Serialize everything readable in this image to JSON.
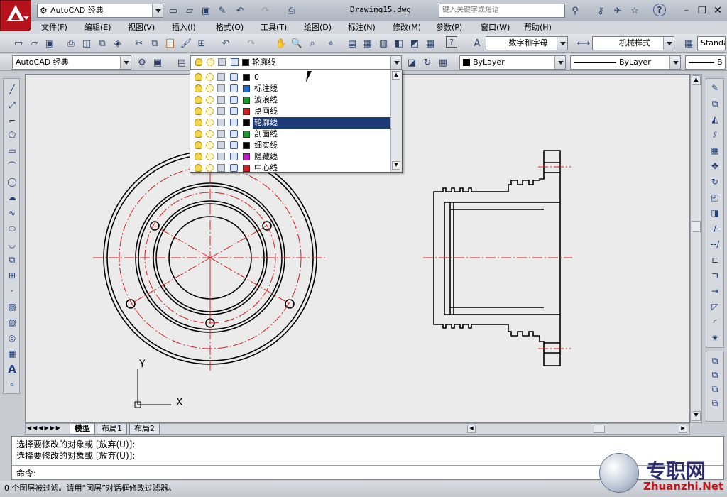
{
  "window": {
    "title": "Drawing15.dwg"
  },
  "titlebar": {
    "workspace": "AutoCAD 经典",
    "search_placeholder": "键入关键字或短语",
    "help_glyph": "?"
  },
  "menu": [
    "文件(F)",
    "编辑(E)",
    "视图(V)",
    "插入(I)",
    "格式(O)",
    "工具(T)",
    "绘图(D)",
    "标注(N)",
    "修改(M)",
    "参数(P)",
    "窗口(W)",
    "帮助(H)"
  ],
  "toolbar1": {
    "text_style": "数字和字母",
    "dim_style": "机械样式",
    "table_style": "Standa"
  },
  "toolbar2": {
    "workspace": "AutoCAD 经典",
    "current_layer": "轮廓线",
    "color": "ByLayer",
    "linetype": "ByLayer",
    "lineweight": "B"
  },
  "layers": [
    {
      "name": "0",
      "color": "#000000"
    },
    {
      "name": "标注线",
      "color": "#1e6fd9"
    },
    {
      "name": "波浪线",
      "color": "#1a9b2c"
    },
    {
      "name": "点画线",
      "color": "#d42020"
    },
    {
      "name": "轮廓线",
      "color": "#000000",
      "selected": true
    },
    {
      "name": "剖面线",
      "color": "#1a9b2c"
    },
    {
      "name": "细实线",
      "color": "#000000"
    },
    {
      "name": "隐藏线",
      "color": "#c21ad0"
    },
    {
      "name": "中心线",
      "color": "#d42020"
    }
  ],
  "tabs": {
    "model": "模型",
    "layout1": "布局1",
    "layout2": "布局2"
  },
  "ucs": {
    "x": "X",
    "y": "Y"
  },
  "command": {
    "line1": "选择要修改的对象或 [放弃(U)]:",
    "line2": "选择要修改的对象或 [放弃(U)]:",
    "prompt": "命令:"
  },
  "status": {
    "message": "0 个图层被过滤。请用“图层”对话框修改过滤器。"
  },
  "watermark": {
    "cn": "专职网",
    "en": "Zhuanzhi.Net"
  }
}
